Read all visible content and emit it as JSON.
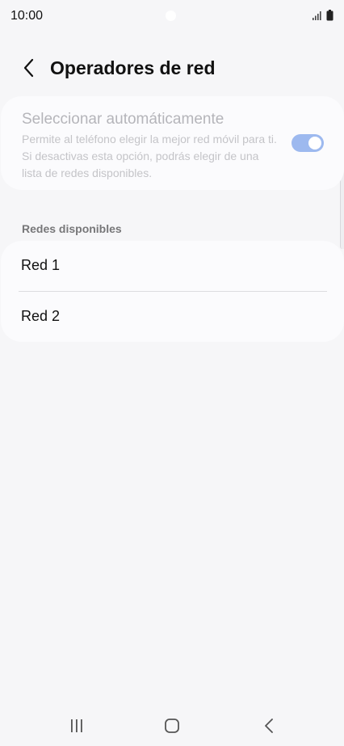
{
  "status_bar": {
    "time": "10:00",
    "icons": [
      "signal-icon",
      "battery-icon"
    ]
  },
  "header": {
    "back_icon": "chevron-left-icon",
    "title": "Operadores de red"
  },
  "auto_select": {
    "title": "Seleccionar automáticamente",
    "description": "Permite al teléfono elegir la mejor red móvil para ti. Si desactivas esta opción, podrás elegir de una lista de redes disponibles.",
    "toggle_on": true,
    "toggle_color": "#9db9ef"
  },
  "networks": {
    "section_title": "Redes disponibles",
    "items": [
      {
        "label": "Red 1"
      },
      {
        "label": "Red 2"
      }
    ]
  },
  "nav_bar": {
    "icons": [
      "recent-apps-icon",
      "home-icon",
      "back-icon"
    ]
  }
}
